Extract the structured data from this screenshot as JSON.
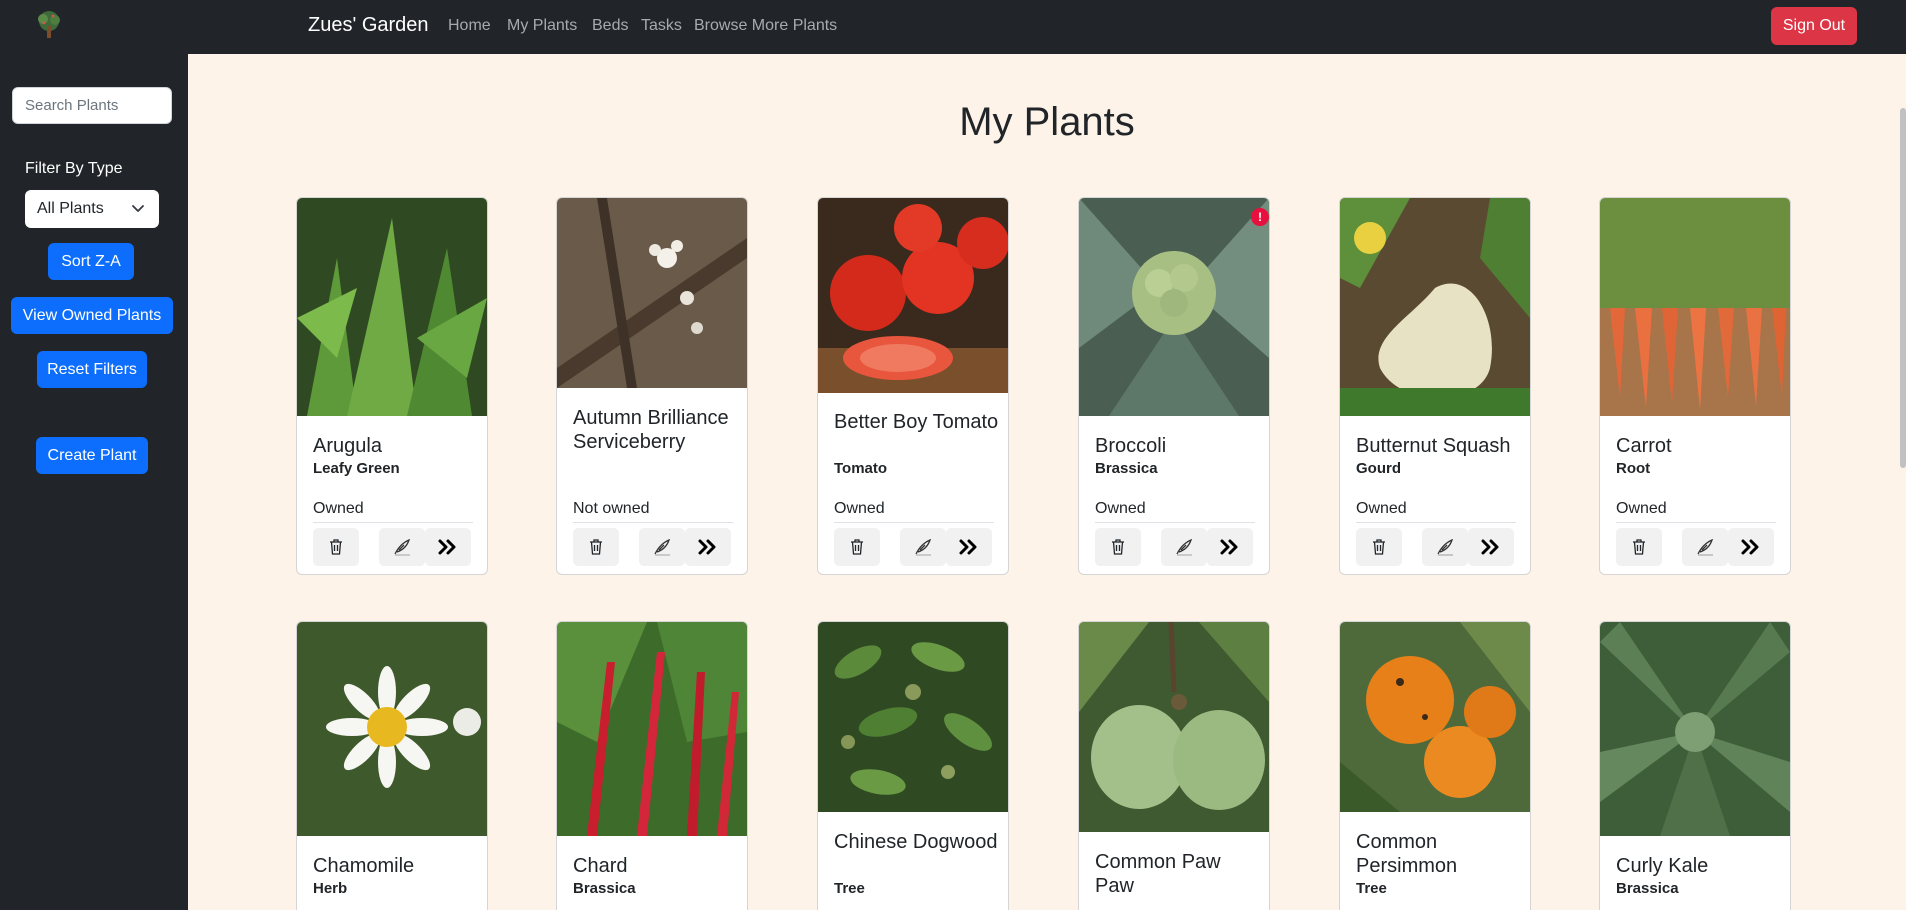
{
  "navbar": {
    "brand": "Zues' Garden",
    "links": [
      "Home",
      "My Plants",
      "Beds",
      "Tasks",
      "Browse More Plants"
    ],
    "signout_label": "Sign Out"
  },
  "sidebar": {
    "search_placeholder": "Search Plants",
    "filter_label": "Filter By Type",
    "filter_value": "All Plants",
    "sort_label": "Sort Z-A",
    "owned_label": "View Owned Plants",
    "reset_label": "Reset Filters",
    "create_label": "Create Plant"
  },
  "page": {
    "title": "My Plants"
  },
  "colors": {
    "navbar": "#212529",
    "primary": "#0d6efd",
    "danger": "#dc3545",
    "background": "#fdf3e8"
  },
  "plants": [
    {
      "name": "Arugula",
      "type": "Leafy Green",
      "status": "Owned"
    },
    {
      "name": "Autumn Brilliance Serviceberry",
      "type": "",
      "status": "Not owned"
    },
    {
      "name": "Better Boy Tomato",
      "type": "Tomato",
      "status": "Owned"
    },
    {
      "name": "Broccoli",
      "type": "Brassica",
      "status": "Owned",
      "alert": "!"
    },
    {
      "name": "Butternut Squash",
      "type": "Gourd",
      "status": "Owned"
    },
    {
      "name": "Carrot",
      "type": "Root",
      "status": "Owned"
    },
    {
      "name": "Chamomile",
      "type": "Herb"
    },
    {
      "name": "Chard",
      "type": "Brassica"
    },
    {
      "name": "Chinese Dogwood",
      "type": "Tree"
    },
    {
      "name": "Common Paw Paw",
      "type": ""
    },
    {
      "name": "Common Persimmon",
      "type": "Tree"
    },
    {
      "name": "Curly Kale",
      "type": "Brassica"
    }
  ]
}
